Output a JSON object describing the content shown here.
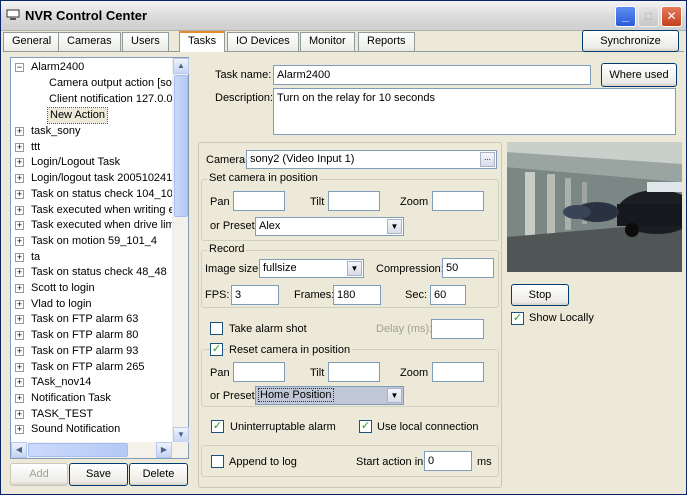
{
  "window": {
    "title": "NVR Control Center"
  },
  "tabs": [
    "General",
    "Cameras",
    "Users",
    "Tasks",
    "IO Devices",
    "Monitor",
    "Reports"
  ],
  "active_tab": "Tasks",
  "synchronize_label": "Synchronize",
  "tree": {
    "root": "Alarm2400",
    "children": [
      "Camera output action [sor",
      "Client notification 127.0.0.",
      "New Action"
    ],
    "items": [
      "task_sony",
      "ttt",
      "Login/Logout Task",
      "Login/logout task 200510241",
      "Task on status check 104_10",
      "Task executed when writing e",
      "Task executed when drive lim",
      "Task on motion 59_101_4",
      "ta",
      "Task on status check 48_48",
      "Scott to login",
      "Vlad to login",
      "Task on FTP alarm 63",
      "Task on FTP alarm 80",
      "Task on FTP alarm 93",
      "Task on FTP alarm 265",
      "TAsk_nov14",
      "Notification Task",
      "TASK_TEST",
      "Sound Notification"
    ]
  },
  "bottom_buttons": {
    "add": "Add",
    "save": "Save",
    "delete": "Delete"
  },
  "task": {
    "name_label": "Task name:",
    "name": "Alarm2400",
    "where_used": "Where used",
    "desc_label": "Description:",
    "desc": "Turn on the relay for 10 seconds"
  },
  "camera": {
    "label": "Camera",
    "value": "sony2 (Video Input 1)",
    "browse": "...",
    "set_position_legend": "Set camera in position",
    "pan": "Pan",
    "tilt": "Tilt",
    "zoom": "Zoom",
    "or_preset": "or Preset",
    "preset1": "Alex"
  },
  "record": {
    "legend": "Record",
    "image_size_label": "Image size:",
    "image_size": "fullsize",
    "compression_label": "Compression:",
    "compression": "50",
    "fps_label": "FPS:",
    "fps": "3",
    "frames_label": "Frames:",
    "frames": "180",
    "sec_label": "Sec:",
    "sec": "60"
  },
  "alarm": {
    "take_shot": "Take alarm shot",
    "delay_label": "Delay (ms):"
  },
  "reset": {
    "label": "Reset camera in position",
    "pan": "Pan",
    "tilt": "Tilt",
    "zoom": "Zoom",
    "or_preset": "or Preset",
    "preset": "Home Position"
  },
  "options": {
    "uninterruptable": "Uninterruptable alarm",
    "local_conn": "Use local connection",
    "append_log": "Append to log",
    "start_in_label": "Start action in",
    "start_in": "0",
    "ms": "ms"
  },
  "preview_controls": {
    "stop": "Stop",
    "show_locally": "Show Locally"
  }
}
